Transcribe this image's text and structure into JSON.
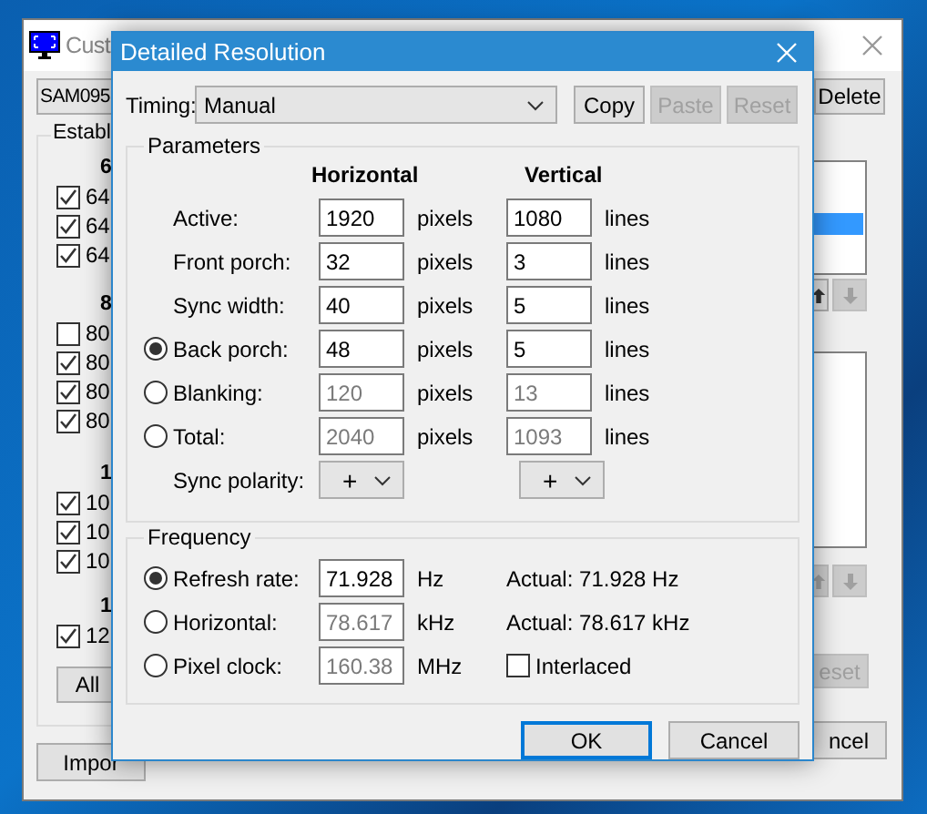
{
  "back_window": {
    "title": "Cust",
    "device": "SAM095",
    "delete_button": "Delete",
    "group_label": "Establ",
    "sections": [
      {
        "heading": "6",
        "items": [
          {
            "label": "64",
            "checked": true
          },
          {
            "label": "64",
            "checked": true
          },
          {
            "label": "64",
            "checked": true
          }
        ]
      },
      {
        "heading": "8",
        "items": [
          {
            "label": "80",
            "checked": false
          },
          {
            "label": "80",
            "checked": true
          },
          {
            "label": "80",
            "checked": true
          },
          {
            "label": "80",
            "checked": true
          }
        ]
      },
      {
        "heading": "1",
        "items": [
          {
            "label": "10",
            "checked": true
          },
          {
            "label": "10",
            "checked": true
          },
          {
            "label": "10",
            "checked": true
          }
        ]
      },
      {
        "heading": "1",
        "items": [
          {
            "label": "12",
            "checked": true
          }
        ]
      }
    ],
    "all_button": "All",
    "import_button": "Impor",
    "lists": [
      {
        "rows": [
          {
            "selected": false
          },
          {
            "selected": false
          },
          {
            "selected": true
          }
        ],
        "buttons": [
          {
            "kind": "up",
            "disabled": false
          },
          {
            "kind": "down",
            "disabled": true
          }
        ]
      },
      {
        "buttons": [
          {
            "kind": "up",
            "disabled": true
          },
          {
            "kind": "down",
            "disabled": true
          }
        ]
      }
    ],
    "reset_button": {
      "label": "eset",
      "disabled": true
    },
    "cancel_button": "ncel"
  },
  "dialog": {
    "title": "Detailed Resolution",
    "timing": {
      "label": "Timing:",
      "value": "Manual"
    },
    "actions": [
      {
        "label": "Copy",
        "disabled": false
      },
      {
        "label": "Paste",
        "disabled": true
      },
      {
        "label": "Reset",
        "disabled": true
      }
    ],
    "parameters": {
      "title": "Parameters",
      "columns": [
        "Horizontal",
        "Vertical"
      ],
      "rows": [
        {
          "kind": "field",
          "label": "Active:",
          "h": "1920",
          "h_unit": "pixels",
          "v": "1080",
          "v_unit": "lines",
          "disabled": false
        },
        {
          "kind": "field",
          "label": "Front porch:",
          "h": "32",
          "h_unit": "pixels",
          "v": "3",
          "v_unit": "lines",
          "disabled": false
        },
        {
          "kind": "field",
          "label": "Sync width:",
          "h": "40",
          "h_unit": "pixels",
          "v": "5",
          "v_unit": "lines",
          "disabled": false
        },
        {
          "kind": "radio",
          "selected": true,
          "label": "Back porch:",
          "h": "48",
          "h_unit": "pixels",
          "v": "5",
          "v_unit": "lines",
          "disabled": false
        },
        {
          "kind": "radio",
          "selected": false,
          "label": "Blanking:",
          "h": "120",
          "h_unit": "pixels",
          "v": "13",
          "v_unit": "lines",
          "disabled": true
        },
        {
          "kind": "radio",
          "selected": false,
          "label": "Total:",
          "h": "2040",
          "h_unit": "pixels",
          "v": "1093",
          "v_unit": "lines",
          "disabled": true
        },
        {
          "kind": "select",
          "label": "Sync polarity:",
          "h": "+",
          "v": "+"
        }
      ]
    },
    "frequency": {
      "title": "Frequency",
      "rows": [
        {
          "selected": true,
          "label": "Refresh rate:",
          "value": "71.928",
          "unit": "Hz",
          "disabled": false,
          "aside": {
            "kind": "text",
            "text": "Actual: 71.928 Hz"
          }
        },
        {
          "selected": false,
          "label": "Horizontal:",
          "value": "78.617",
          "unit": "kHz",
          "disabled": true,
          "aside": {
            "kind": "text",
            "text": "Actual: 78.617 kHz"
          }
        },
        {
          "selected": false,
          "label": "Pixel clock:",
          "value": "160.38",
          "unit": "MHz",
          "disabled": true,
          "aside": {
            "kind": "checkbox",
            "label": "Interlaced",
            "checked": false
          }
        }
      ]
    },
    "buttons": [
      {
        "label": "OK",
        "default": true
      },
      {
        "label": "Cancel",
        "default": false
      }
    ]
  }
}
